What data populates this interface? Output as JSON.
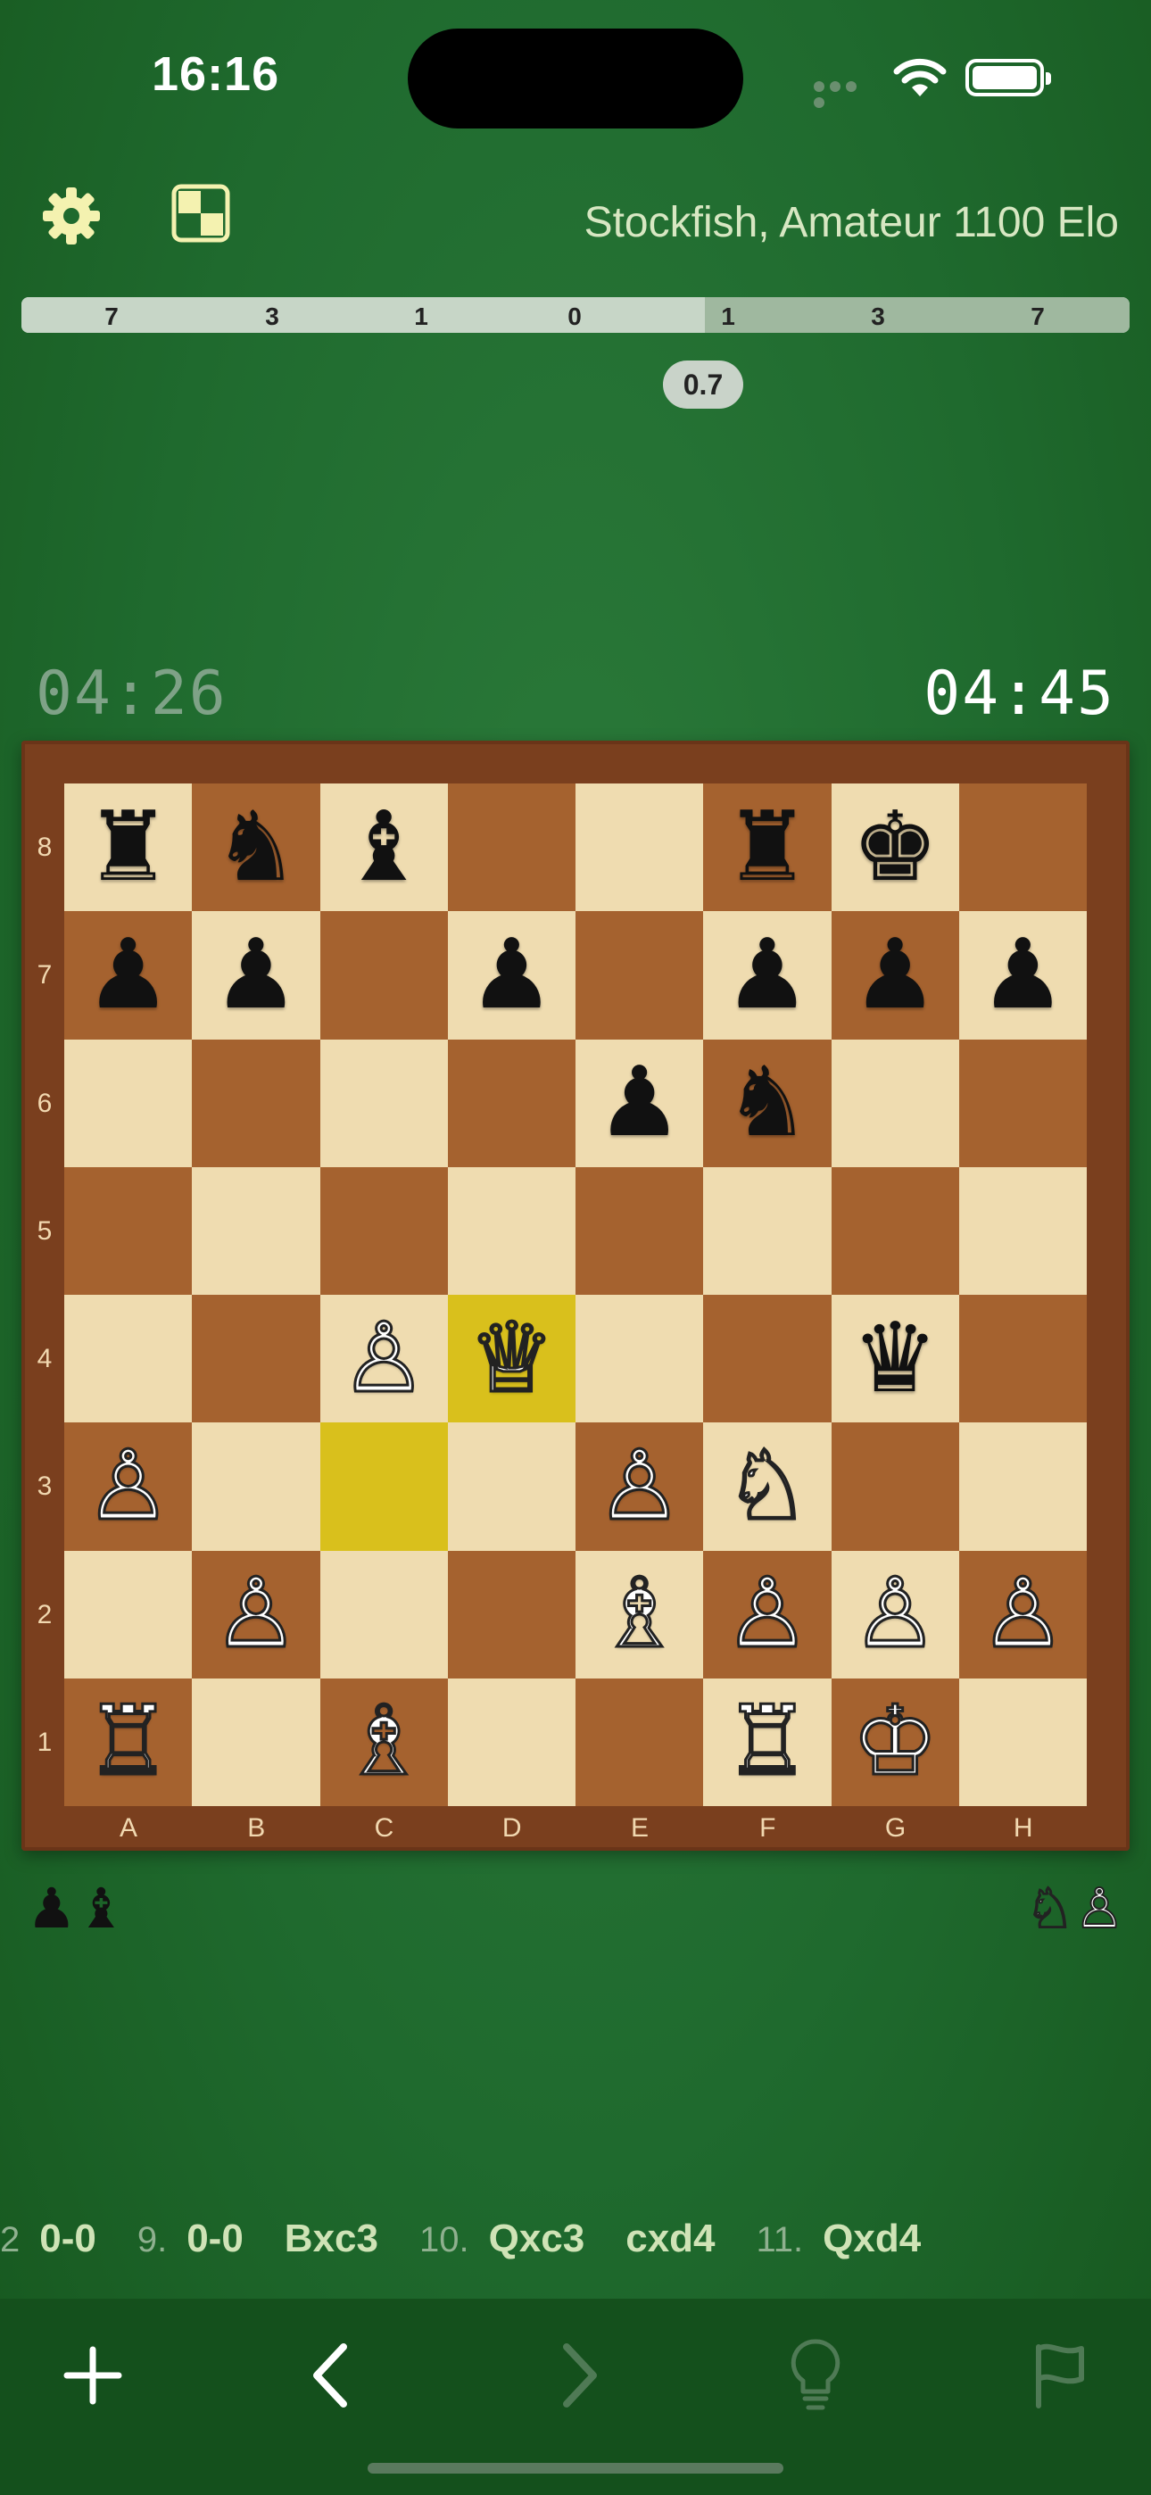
{
  "status_bar": {
    "time": "16:16"
  },
  "header": {
    "engine_label": "Stockfish, Amateur 1100 Elo"
  },
  "eval_bar": {
    "ticks": [
      "7",
      "3",
      "1",
      "0",
      "1",
      "3",
      "7"
    ],
    "score": "0.7"
  },
  "clocks": {
    "opponent": "04:26",
    "player": "04:45"
  },
  "board": {
    "ranks": [
      "8",
      "7",
      "6",
      "5",
      "4",
      "3",
      "2",
      "1"
    ],
    "files": [
      "A",
      "B",
      "C",
      "D",
      "E",
      "F",
      "G",
      "H"
    ],
    "highlight_squares": [
      "d4",
      "c3"
    ],
    "pieces": {
      "a8": "♜",
      "b8": "♞",
      "c8": "♝",
      "f8": "♜",
      "g8": "♚",
      "a7": "♟",
      "b7": "♟",
      "d7": "♟",
      "f7": "♟",
      "g7": "♟",
      "h7": "♟",
      "e6": "♟",
      "f6": "♞",
      "c4": "♙",
      "d4": "♕",
      "g4": "♛",
      "a3": "♙",
      "e3": "♙",
      "f3": "♘",
      "b2": "♙",
      "e2": "♗",
      "f2": "♙",
      "g2": "♙",
      "h2": "♙",
      "a1": "♖",
      "c1": "♗",
      "f1": "♖",
      "g1": "♔"
    }
  },
  "captured": {
    "by_white": "♟♝",
    "by_black": "♘♙"
  },
  "moves": [
    {
      "text": "2",
      "kind": "num"
    },
    {
      "text": "0-0",
      "kind": "move"
    },
    {
      "text": "9.",
      "kind": "num"
    },
    {
      "text": "0-0",
      "kind": "move"
    },
    {
      "text": "Bxc3",
      "kind": "move"
    },
    {
      "text": "10.",
      "kind": "num"
    },
    {
      "text": "Qxc3",
      "kind": "move"
    },
    {
      "text": "cxd4",
      "kind": "move"
    },
    {
      "text": "11.",
      "kind": "num"
    },
    {
      "text": "Qxd4",
      "kind": "move"
    }
  ],
  "toolbar": {
    "icons": [
      "plus-icon",
      "back-chevron-icon",
      "forward-chevron-icon",
      "lightbulb-icon",
      "flag-icon"
    ]
  },
  "colors": {
    "accent_highlight": "#d9c01c",
    "background": "#1f6a2e"
  }
}
